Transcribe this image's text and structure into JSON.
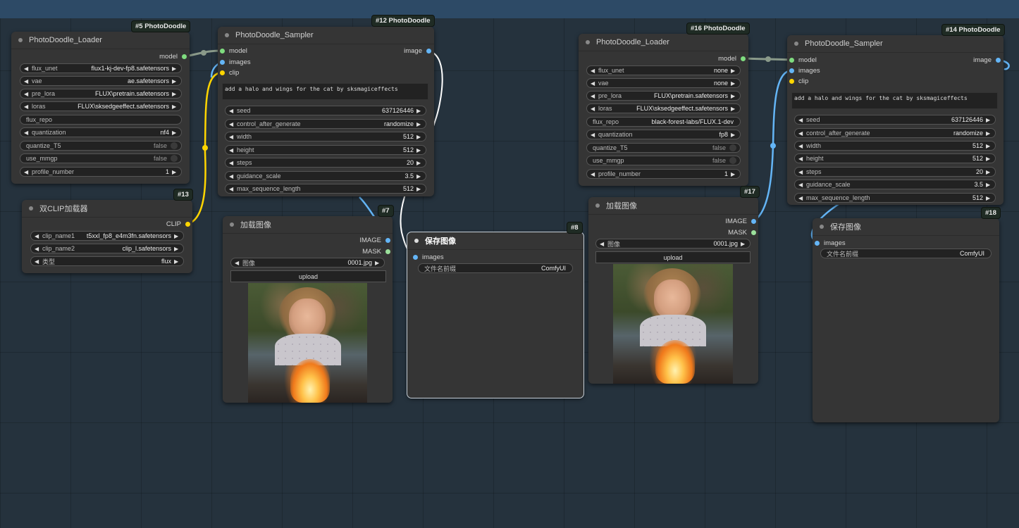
{
  "colors": {
    "canvas": "#25323d",
    "node": "#353535",
    "model_link": "#8a9a8a",
    "clip_link": "#ffd500",
    "image_link": "#64b5f6"
  },
  "nodes": {
    "loader1": {
      "badge": "#5 PhotoDoodle",
      "title": "PhotoDoodle_Loader",
      "output": "model",
      "widgets": {
        "flux_unet": {
          "label": "flux_unet",
          "value": "flux1-kj-dev-fp8.safetensors"
        },
        "vae": {
          "label": "vae",
          "value": "ae.safetensors"
        },
        "pre_lora": {
          "label": "pre_lora",
          "value": "FLUX\\pretrain.safetensors"
        },
        "loras": {
          "label": "loras",
          "value": "FLUX\\sksedgeeffect.safetensors"
        },
        "flux_repo": {
          "label": "flux_repo",
          "value": ""
        },
        "quantization": {
          "label": "quantization",
          "value": "nf4"
        },
        "quantize_T5": {
          "label": "quantize_T5",
          "value": "false"
        },
        "use_mmgp": {
          "label": "use_mmgp",
          "value": "false"
        },
        "profile_number": {
          "label": "profile_number",
          "value": "1"
        }
      }
    },
    "sampler1": {
      "badge": "#12 PhotoDoodle",
      "title": "PhotoDoodle_Sampler",
      "inputs": [
        "model",
        "images",
        "clip"
      ],
      "output": "image",
      "prompt": "add a halo and wings for the cat by sksmagiceffects",
      "widgets": {
        "seed": {
          "label": "seed",
          "value": "637126446"
        },
        "control_after_generate": {
          "label": "control_after_generate",
          "value": "randomize"
        },
        "width": {
          "label": "width",
          "value": "512"
        },
        "height": {
          "label": "height",
          "value": "512"
        },
        "steps": {
          "label": "steps",
          "value": "20"
        },
        "guidance_scale": {
          "label": "guidance_scale",
          "value": "3.5"
        },
        "max_sequence_length": {
          "label": "max_sequence_length",
          "value": "512"
        }
      }
    },
    "dualclip": {
      "badge": "#13",
      "title": "双CLIP加载器",
      "output": "CLIP",
      "widgets": {
        "clip_name1": {
          "label": "clip_name1",
          "value": "t5xxl_fp8_e4m3fn.safetensors"
        },
        "clip_name2": {
          "label": "clip_name2",
          "value": "clip_l.safetensors"
        },
        "type": {
          "label": "类型",
          "value": "flux"
        }
      }
    },
    "loadimage1": {
      "badge": "#7",
      "title": "加载图像",
      "outputs": [
        "IMAGE",
        "MASK"
      ],
      "image_label": "图像",
      "image_value": "0001.jpg",
      "upload": "upload"
    },
    "save1": {
      "badge": "#8",
      "title": "保存图像",
      "input": "images",
      "prefix_label": "文件名前缀",
      "prefix_value": "ComfyUI"
    },
    "loader2": {
      "badge": "#16 PhotoDoodle",
      "title": "PhotoDoodle_Loader",
      "output": "model",
      "widgets": {
        "flux_unet": {
          "label": "flux_unet",
          "value": "none"
        },
        "vae": {
          "label": "vae",
          "value": "none"
        },
        "pre_lora": {
          "label": "pre_lora",
          "value": "FLUX\\pretrain.safetensors"
        },
        "loras": {
          "label": "loras",
          "value": "FLUX\\sksedgeeffect.safetensors"
        },
        "flux_repo": {
          "label": "flux_repo",
          "value": "black-forest-labs/FLUX.1-dev"
        },
        "quantization": {
          "label": "quantization",
          "value": "fp8"
        },
        "quantize_T5": {
          "label": "quantize_T5",
          "value": "false"
        },
        "use_mmgp": {
          "label": "use_mmgp",
          "value": "false"
        },
        "profile_number": {
          "label": "profile_number",
          "value": "1"
        }
      }
    },
    "loadimage2": {
      "badge": "#17",
      "title": "加载图像",
      "outputs": [
        "IMAGE",
        "MASK"
      ],
      "image_label": "图像",
      "image_value": "0001.jpg",
      "upload": "upload"
    },
    "sampler2": {
      "badge": "#14 PhotoDoodle",
      "title": "PhotoDoodle_Sampler",
      "inputs": [
        "model",
        "images",
        "clip"
      ],
      "output": "image",
      "prompt": "add a halo and wings for the cat by sksmagiceffects",
      "widgets": {
        "seed": {
          "label": "seed",
          "value": "637126446"
        },
        "control_after_generate": {
          "label": "control_after_generate",
          "value": "randomize"
        },
        "width": {
          "label": "width",
          "value": "512"
        },
        "height": {
          "label": "height",
          "value": "512"
        },
        "steps": {
          "label": "steps",
          "value": "20"
        },
        "guidance_scale": {
          "label": "guidance_scale",
          "value": "3.5"
        },
        "max_sequence_length": {
          "label": "max_sequence_length",
          "value": "512"
        }
      }
    },
    "save2": {
      "badge": "#18",
      "title": "保存图像",
      "input": "images",
      "prefix_label": "文件名前缀",
      "prefix_value": "ComfyUI"
    }
  }
}
